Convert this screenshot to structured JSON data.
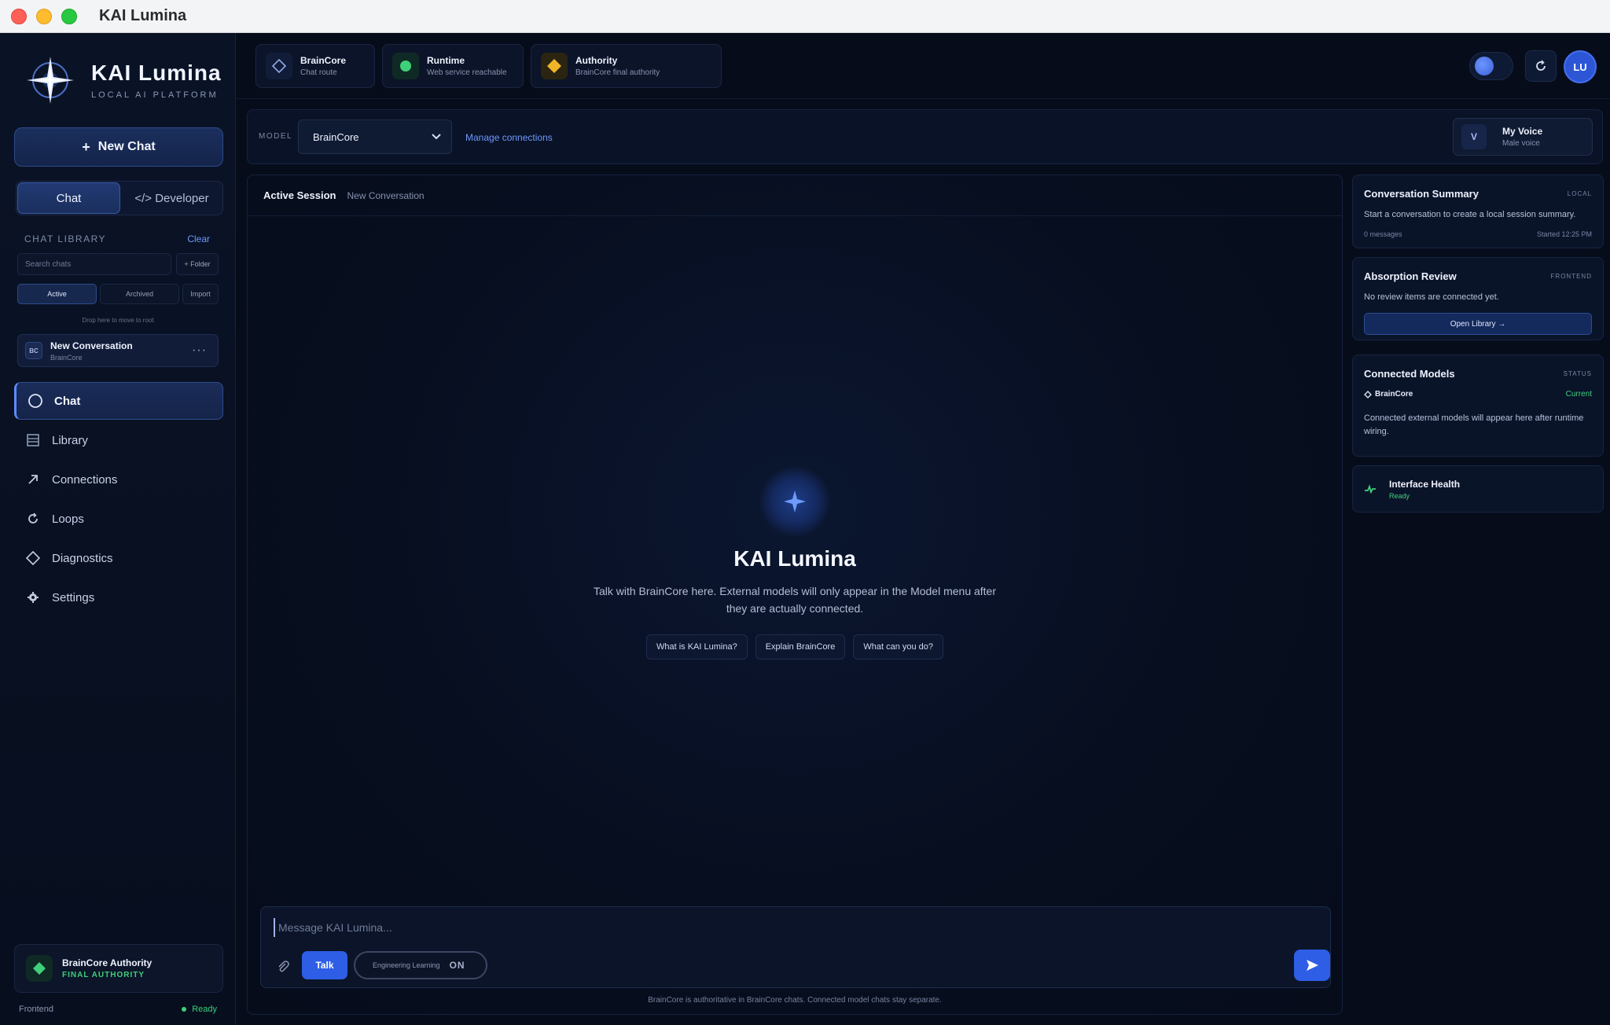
{
  "window": {
    "title": "KAI Lumina"
  },
  "brand": {
    "name": "KAI Lumina",
    "tagline": "LOCAL AI PLATFORM"
  },
  "sidebar": {
    "new_chat_label": "New Chat",
    "mode_tabs": {
      "chat": "Chat",
      "developer": "</> Developer"
    },
    "library": {
      "heading": "CHAT LIBRARY",
      "clear_label": "Clear",
      "search_placeholder": "Search chats",
      "folder_label": "+ Folder",
      "filters": {
        "active": "Active",
        "archived": "Archived",
        "import": "Import"
      },
      "drop_hint": "Drop here to move to root",
      "conversations": [
        {
          "badge": "BC",
          "title": "New Conversation",
          "subtitle": "BrainCore",
          "more": "···"
        }
      ]
    },
    "nav": {
      "chat": "Chat",
      "library": "Library",
      "connections": "Connections",
      "loops": "Loops",
      "diagnostics": "Diagnostics",
      "settings": "Settings"
    },
    "authority": {
      "title": "BrainCore Authority",
      "subtitle": "FINAL AUTHORITY"
    },
    "footer": {
      "left": "Frontend",
      "status": "Ready"
    }
  },
  "status_pills": {
    "braincore": {
      "title": "BrainCore",
      "subtitle": "Chat route"
    },
    "runtime": {
      "title": "Runtime",
      "subtitle": "Web service reachable"
    },
    "authority": {
      "title": "Authority",
      "subtitle": "BrainCore final authority"
    }
  },
  "header": {
    "avatar_initials": "LU"
  },
  "model_bar": {
    "label": "MODEL",
    "selected": "BrainCore",
    "manage_label": "Manage connections",
    "voice": {
      "badge": "V",
      "title": "My Voice",
      "subtitle": "Male voice"
    }
  },
  "chat": {
    "session_label": "Active Session",
    "session_name": "New Conversation",
    "hero_title": "KAI Lumina",
    "hero_desc": "Talk with BrainCore here. External models will only appear in the Model menu after they are actually connected.",
    "chips": [
      "What is KAI Lumina?",
      "Explain BrainCore",
      "What can you do?"
    ],
    "composer": {
      "placeholder": "Message KAI Lumina...",
      "talk_label": "Talk",
      "engineering_label": "Engineering Learning",
      "engineering_state": "ON"
    },
    "footnote": "BrainCore is authoritative in BrainCore chats. Connected model chats stay separate."
  },
  "right_rail": {
    "summary": {
      "title": "Conversation Summary",
      "tag": "LOCAL",
      "text": "Start a conversation to create a local session summary.",
      "messages": "0 messages",
      "started": "Started 12:25 PM"
    },
    "absorption": {
      "title": "Absorption Review",
      "tag": "FRONTEND",
      "text": "No review items are connected yet.",
      "button": "Open Library →"
    },
    "connected": {
      "title": "Connected Models",
      "tag": "STATUS",
      "model_name": "BrainCore",
      "model_state": "Current",
      "text": "Connected external models will appear here after runtime wiring."
    },
    "health": {
      "title": "Interface Health",
      "status": "Ready"
    }
  },
  "colors": {
    "accent": "#2e5ee6",
    "link": "#6f98ff",
    "success": "#3fd07a",
    "warning": "#f0b429",
    "background": "#060c1a"
  }
}
